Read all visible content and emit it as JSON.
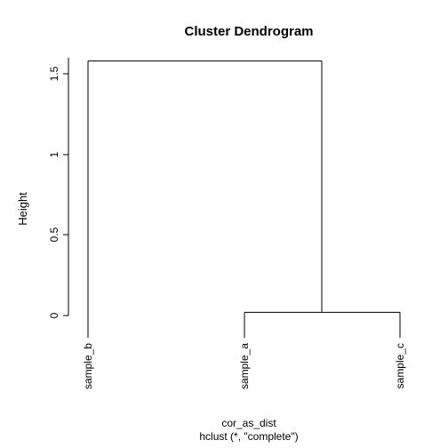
{
  "chart_data": {
    "type": "dendrogram",
    "title": "Cluster Dendrogram",
    "ylabel": "Height",
    "xlabel": "cor_as_dist",
    "sublabel": "hclust (*, \"complete\")",
    "ylim": [
      0.0,
      1.6
    ],
    "yticks": [
      0.0,
      0.5,
      1.0,
      1.5
    ],
    "leaves": [
      "sample_b",
      "sample_a",
      "sample_c"
    ],
    "merges": [
      {
        "left": "sample_a",
        "right": "sample_c",
        "height": 0.02
      },
      {
        "left": "sample_b",
        "right": "__merge0",
        "height": 1.58
      }
    ]
  }
}
